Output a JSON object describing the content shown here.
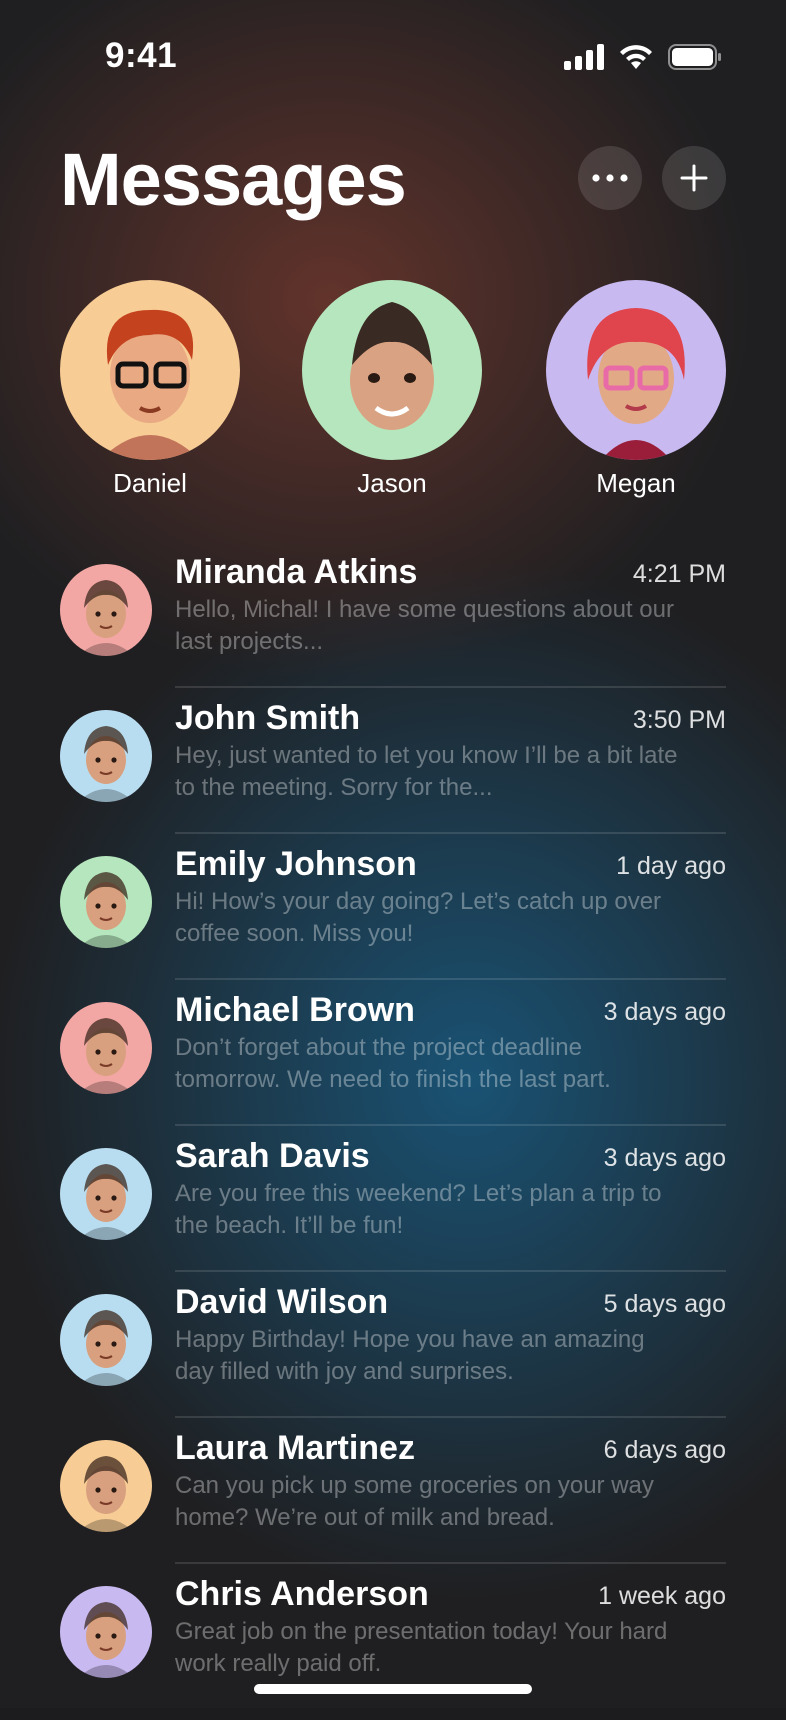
{
  "status_bar": {
    "time": "9:41"
  },
  "header": {
    "title": "Messages"
  },
  "favorites": [
    {
      "name": "Daniel",
      "color": "#f7cc95"
    },
    {
      "name": "Jason",
      "color": "#b5e6bd"
    },
    {
      "name": "Megan",
      "color": "#c9b9f1"
    }
  ],
  "conversations": [
    {
      "name": "Miranda Atkins",
      "time": "4:21 PM",
      "message": "Hello, Michal! I have some questions about our last projects...",
      "color": "#f3a7a4"
    },
    {
      "name": "John Smith",
      "time": "3:50 PM",
      "message": "Hey, just wanted to let you know I’ll be a bit late to the meeting. Sorry for the...",
      "color": "#b9ddf0"
    },
    {
      "name": "Emily Johnson",
      "time": "1 day ago",
      "message": "Hi! How’s your day going? Let’s catch up over coffee soon. Miss you!",
      "color": "#b5e6bd"
    },
    {
      "name": "Michael Brown",
      "time": "3 days ago",
      "message": "Don’t forget about the project deadline tomorrow. We need to finish the last part.",
      "color": "#f3a7a4"
    },
    {
      "name": "Sarah Davis",
      "time": "3 days ago",
      "message": "Are you free this weekend? Let’s plan a trip to the beach. It’ll be fun!",
      "color": "#b9ddf0"
    },
    {
      "name": "David Wilson",
      "time": "5 days ago",
      "message": "Happy Birthday! Hope you have an amazing day filled with joy and surprises.",
      "color": "#b9ddf0"
    },
    {
      "name": "Laura Martinez",
      "time": "6 days ago",
      "message": "Can you pick up some groceries on your way home? We’re out of milk and bread.",
      "color": "#f7cc95"
    },
    {
      "name": "Chris Anderson",
      "time": "1 week ago",
      "message": "Great job on the presentation today! Your hard work really paid off.",
      "color": "#c9b9f1"
    }
  ]
}
